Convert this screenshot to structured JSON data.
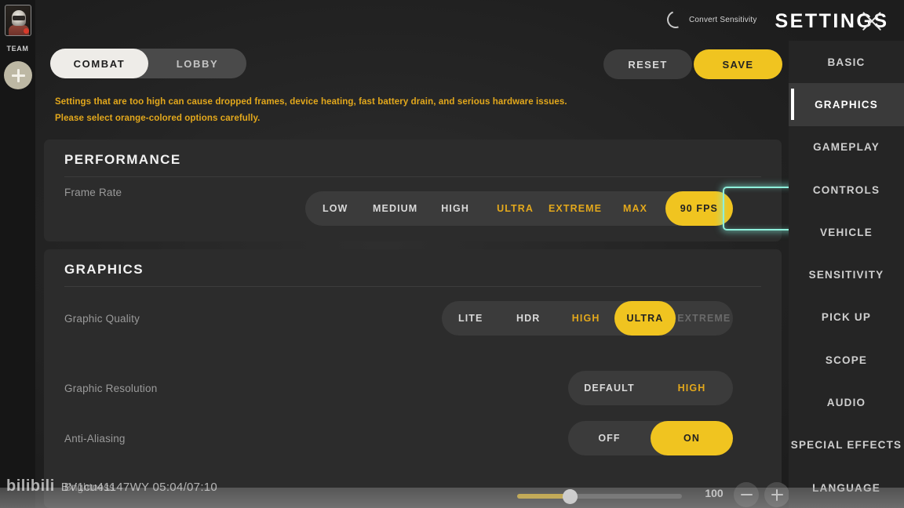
{
  "left_rail": {
    "team_label": "TEAM",
    "avatar_icon": "player-avatar-icon",
    "add_icon": "plus-icon"
  },
  "header": {
    "convert_sensitivity_label": "Convert Sensitivity",
    "convert_sensitivity_icon": "circular-arrow-icon",
    "title": "SETTINGS",
    "close_icon": "close-icon"
  },
  "tabs": [
    {
      "label": "COMBAT",
      "active": true
    },
    {
      "label": "LOBBY",
      "active": false
    }
  ],
  "actions": {
    "reset_label": "RESET",
    "save_label": "SAVE"
  },
  "warning": {
    "line1": "Settings that are too high can cause dropped frames, device heating, fast battery drain, and serious hardware issues.",
    "line2": "Please select orange-colored options carefully."
  },
  "performance": {
    "title": "PERFORMANCE",
    "frame_rate": {
      "label": "Frame Rate",
      "options": [
        {
          "label": "LOW",
          "state": "normal"
        },
        {
          "label": "MEDIUM",
          "state": "normal"
        },
        {
          "label": "HIGH",
          "state": "normal"
        },
        {
          "label": "ULTRA",
          "state": "warn"
        },
        {
          "label": "EXTREME",
          "state": "warn"
        },
        {
          "label": "MAX",
          "state": "warn"
        },
        {
          "label": "90 FPS",
          "state": "selected"
        }
      ],
      "selected": "90 FPS",
      "highlighted": true
    }
  },
  "graphics": {
    "title": "GRAPHICS",
    "graphic_quality": {
      "label": "Graphic Quality",
      "options": [
        {
          "label": "LITE",
          "state": "normal"
        },
        {
          "label": "HDR",
          "state": "normal"
        },
        {
          "label": "HIGH",
          "state": "warn"
        },
        {
          "label": "ULTRA",
          "state": "selected"
        },
        {
          "label": "EXTREME",
          "state": "disabled"
        }
      ],
      "selected": "ULTRA"
    },
    "graphic_resolution": {
      "label": "Graphic Resolution",
      "options": [
        {
          "label": "DEFAULT",
          "state": "normal"
        },
        {
          "label": "HIGH",
          "state": "warn"
        }
      ],
      "selected": "DEFAULT"
    },
    "anti_aliasing": {
      "label": "Anti-Aliasing",
      "options": [
        {
          "label": "OFF",
          "state": "normal"
        },
        {
          "label": "ON",
          "state": "selected"
        }
      ],
      "selected": "ON"
    },
    "brightness": {
      "label": "Brightness",
      "value": "100",
      "minus_icon": "minus-icon",
      "plus_icon": "plus-icon"
    }
  },
  "sidebar": {
    "items": [
      {
        "label": "BASIC",
        "active": false
      },
      {
        "label": "GRAPHICS",
        "active": true
      },
      {
        "label": "GAMEPLAY",
        "active": false
      },
      {
        "label": "CONTROLS",
        "active": false
      },
      {
        "label": "VEHICLE",
        "active": false
      },
      {
        "label": "SENSITIVITY",
        "active": false
      },
      {
        "label": "PICK UP",
        "active": false
      },
      {
        "label": "SCOPE",
        "active": false
      },
      {
        "label": "AUDIO",
        "active": false
      },
      {
        "label": "SPECIAL EFFECTS",
        "active": false
      },
      {
        "label": "LANGUAGE",
        "active": false
      }
    ]
  },
  "watermark": {
    "brand": "bilibili",
    "id_time": "BV1cu41147WY 05:04/07:10"
  },
  "colors": {
    "accent_yellow": "#f0c420",
    "warn_orange": "#e3a81c",
    "highlight_cyan": "#8ff0dc",
    "card_bg": "#2c2c2c",
    "sidebar_bg": "#252525"
  }
}
